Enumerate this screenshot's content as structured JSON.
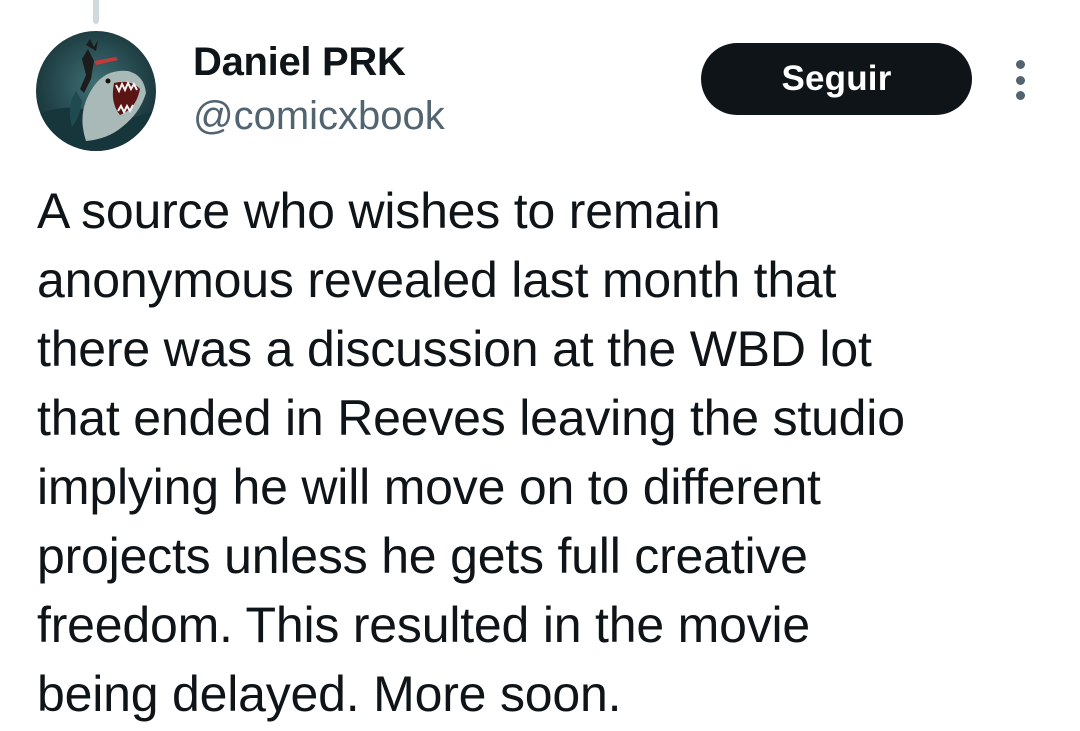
{
  "post": {
    "author": {
      "display_name": "Daniel PRK",
      "handle": "@comicxbook",
      "avatar_icon": "shark-comic-avatar"
    },
    "actions": {
      "follow_label": "Seguir",
      "more_icon": "more-vertical-icon"
    },
    "text": "A source who wishes to remain\nanonymous revealed last month that\nthere was a discussion at the WBD lot\nthat ended in Reeves leaving the studio\nimplying he will move on to different\nprojects unless he gets full creative\nfreedom. This resulted in the movie\nbeing delayed. More soon."
  },
  "colors": {
    "text_primary": "#0f1419",
    "text_secondary": "#536471",
    "follow_button_bg": "#0f1419",
    "follow_button_text": "#ffffff",
    "thread_line": "#cfd9de"
  }
}
